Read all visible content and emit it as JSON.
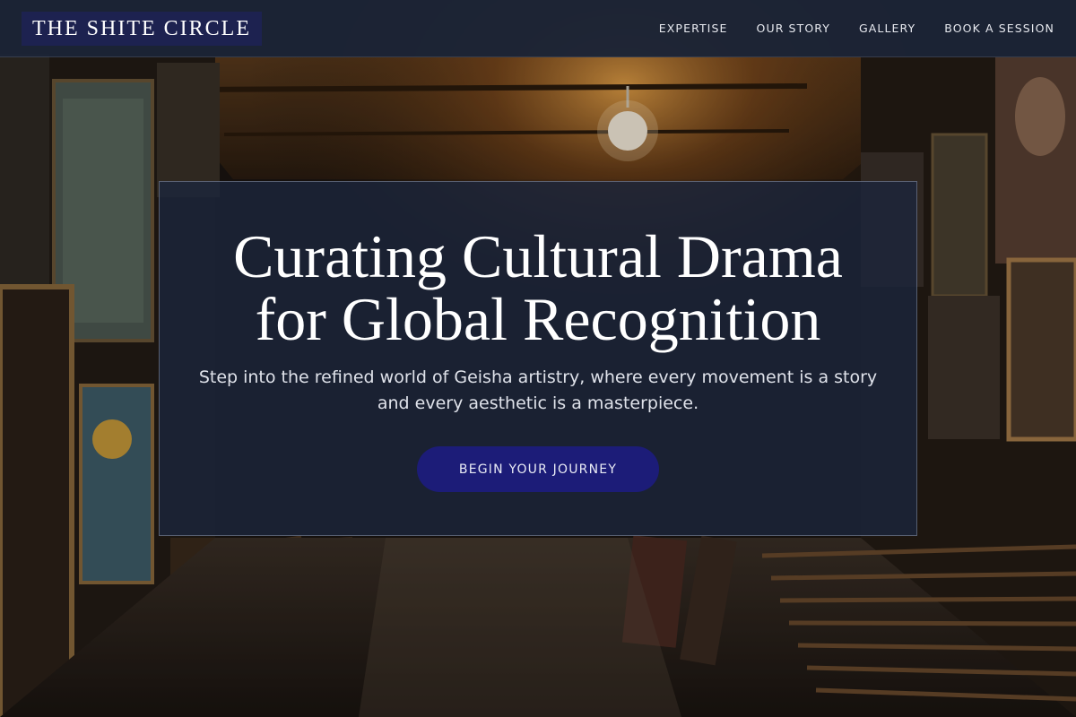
{
  "navbar": {
    "brand": "THE SHITE CIRCLE",
    "links": [
      {
        "label": "EXPERTISE"
      },
      {
        "label": "OUR STORY"
      },
      {
        "label": "GALLERY"
      },
      {
        "label": "BOOK A SESSION"
      }
    ]
  },
  "hero": {
    "title_line1": "Curating Cultural Drama",
    "title_line2": "for Global Recognition",
    "subtitle": "Step into the refined world of Geisha artistry, where every movement is a story and every aesthetic is a masterpiece.",
    "cta_label": "BEGIN YOUR JOURNEY"
  },
  "colors": {
    "navbar_bg": "#1c2436",
    "brand_bg": "#1d2250",
    "cta_bg": "#1c1c78",
    "card_bg": "#1b253c"
  }
}
